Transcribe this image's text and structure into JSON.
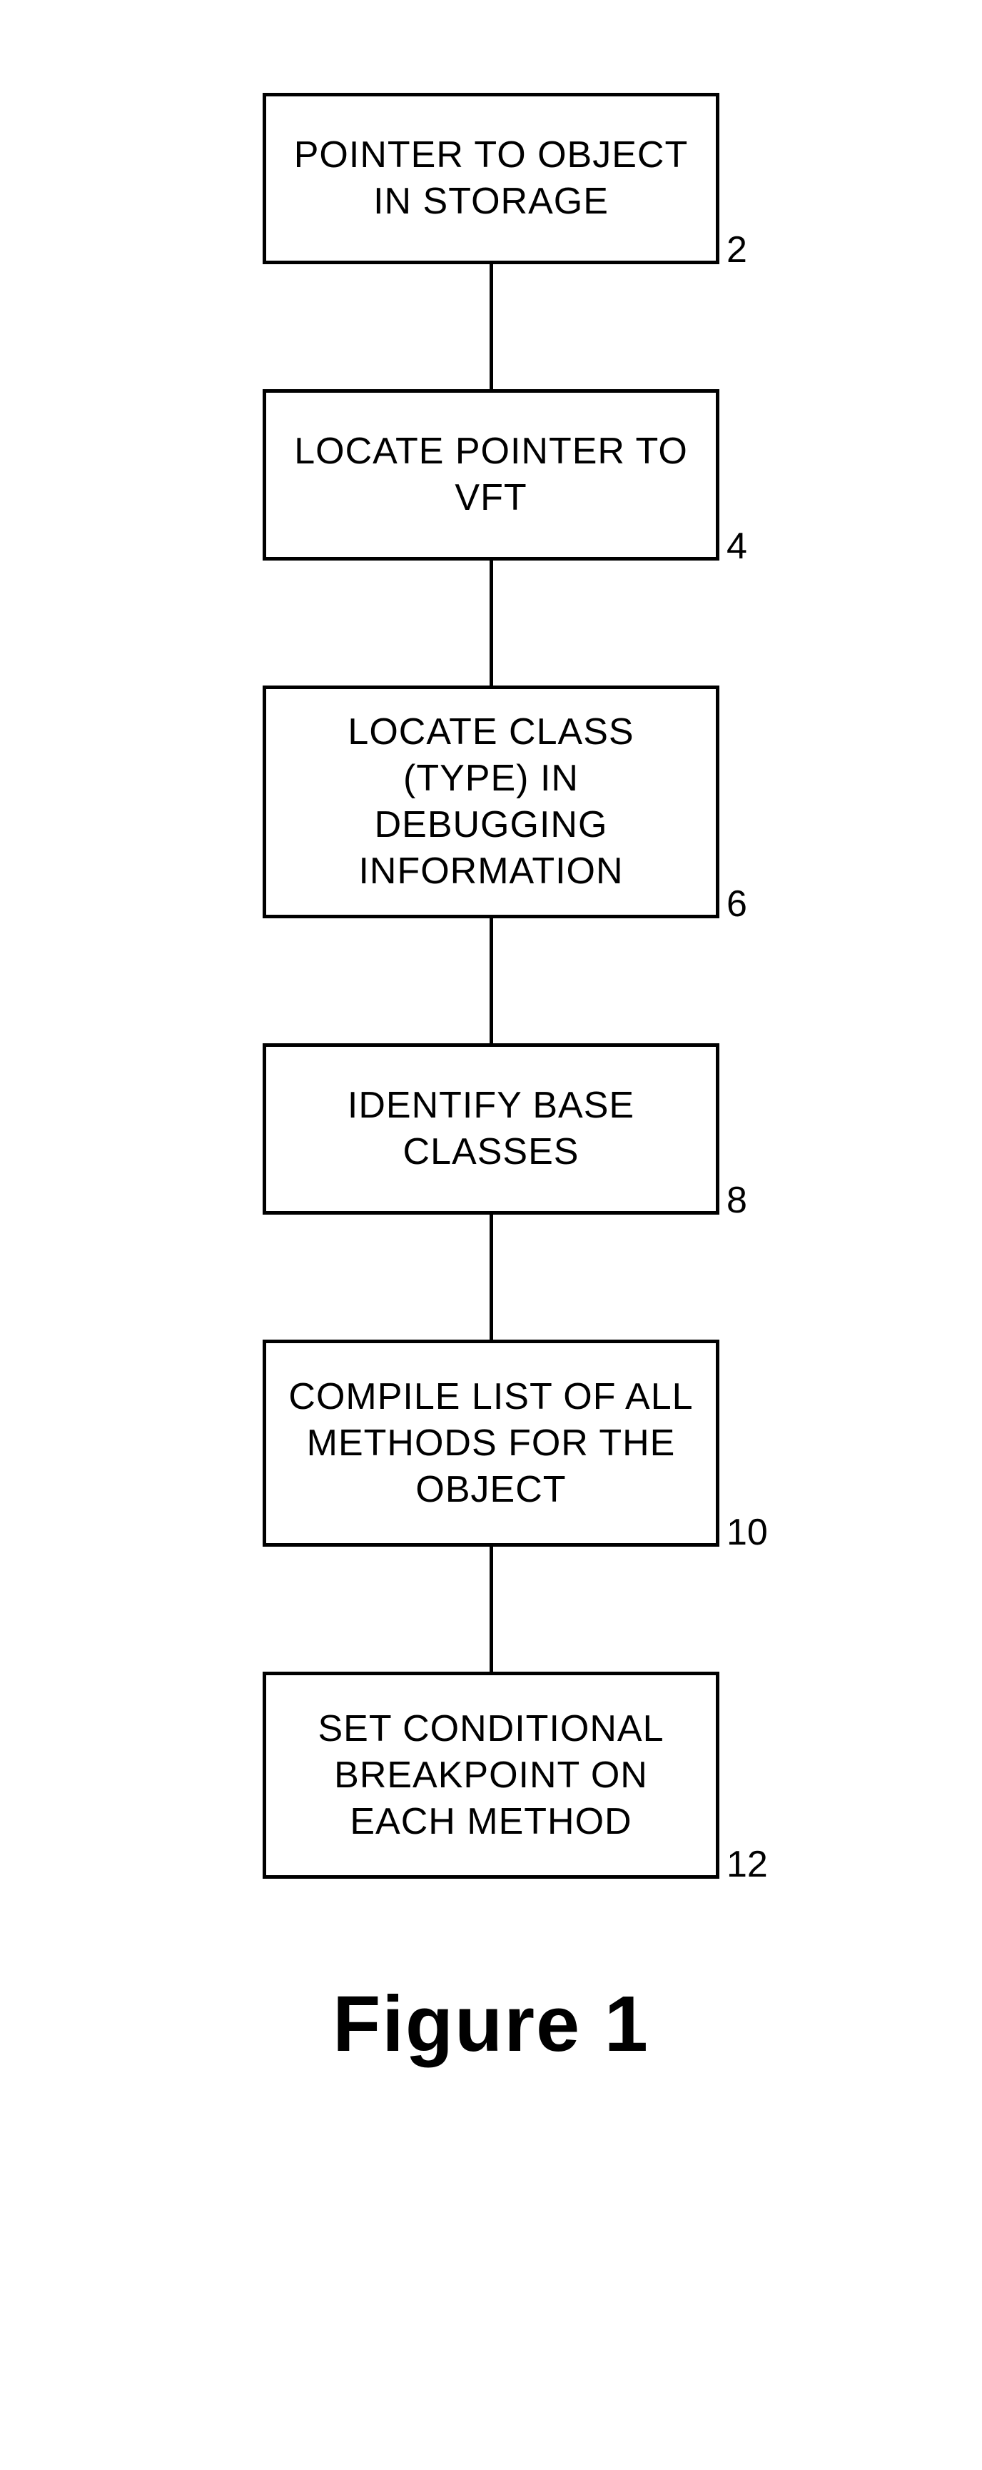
{
  "chart_data": {
    "type": "flowchart",
    "direction": "top-to-bottom",
    "nodes": [
      {
        "id": 2,
        "label": "POINTER TO OBJECT IN STORAGE"
      },
      {
        "id": 4,
        "label": "LOCATE POINTER TO VFT"
      },
      {
        "id": 6,
        "label": "LOCATE CLASS (TYPE) IN DEBUGGING INFORMATION"
      },
      {
        "id": 8,
        "label": "IDENTIFY BASE CLASSES"
      },
      {
        "id": 10,
        "label": "COMPILE LIST OF ALL METHODS FOR THE OBJECT"
      },
      {
        "id": 12,
        "label": "SET CONDITIONAL BREAKPOINT ON EACH METHOD"
      }
    ],
    "edges": [
      {
        "from": 2,
        "to": 4
      },
      {
        "from": 4,
        "to": 6
      },
      {
        "from": 6,
        "to": 8
      },
      {
        "from": 8,
        "to": 10
      },
      {
        "from": 10,
        "to": 12
      }
    ]
  },
  "caption": "Figure 1"
}
